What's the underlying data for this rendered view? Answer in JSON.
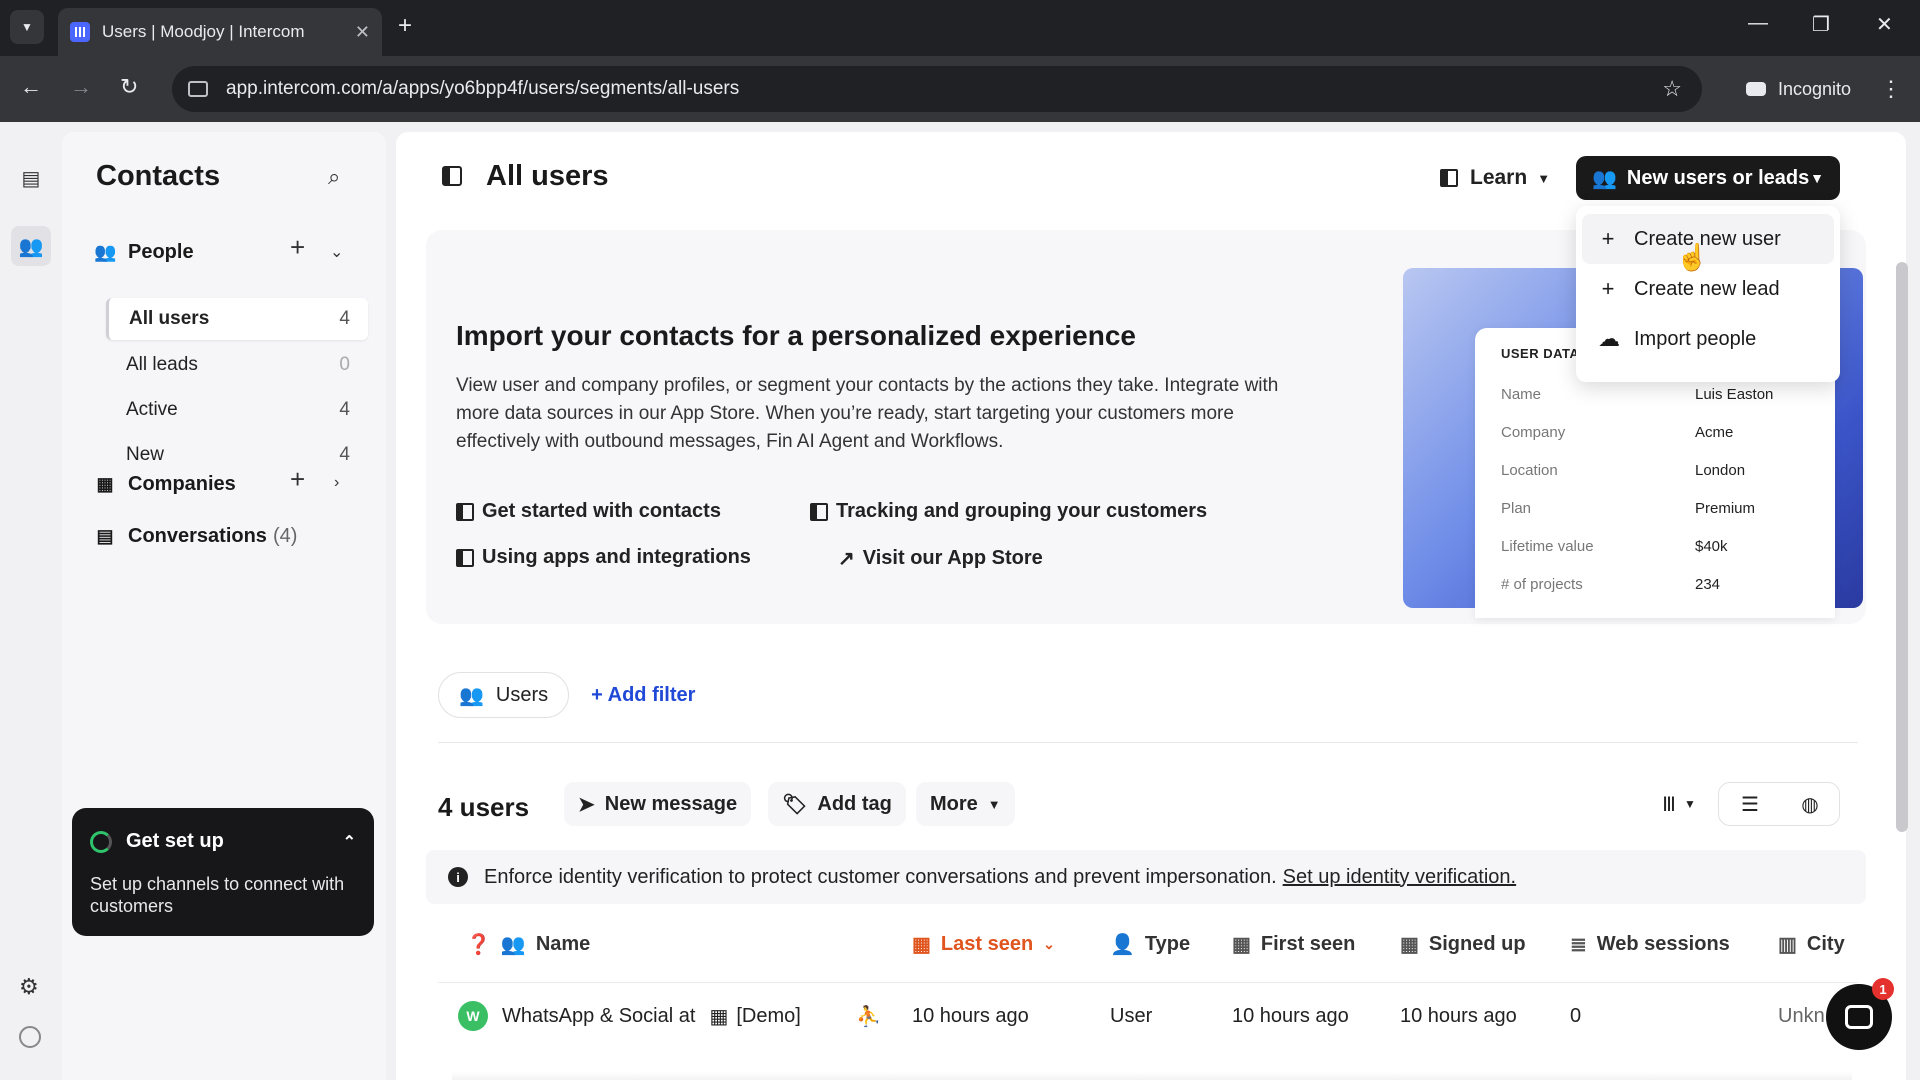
{
  "browser": {
    "tab_title": "Users | Moodjoy | Intercom",
    "url": "app.intercom.com/a/apps/yo6bpp4f/users/segments/all-users",
    "incognito_label": "Incognito"
  },
  "sidebar": {
    "title": "Contacts",
    "people_label": "People",
    "items": [
      {
        "label": "All users",
        "count": "4"
      },
      {
        "label": "All leads",
        "count": "0"
      },
      {
        "label": "Active",
        "count": "4"
      },
      {
        "label": "New",
        "count": "4"
      }
    ],
    "companies_label": "Companies",
    "conversations_label": "Conversations",
    "conversations_count": "(4)",
    "setup": {
      "title": "Get set up",
      "text": "Set up channels to connect with customers"
    }
  },
  "header": {
    "title": "All users",
    "learn_label": "Learn",
    "primary_label": "New users or leads"
  },
  "dropdown": {
    "items": [
      {
        "label": "Create new user"
      },
      {
        "label": "Create new lead"
      },
      {
        "label": "Import people"
      }
    ]
  },
  "import_card": {
    "title": "Import your contacts for a personalized experience",
    "description": "View user and company profiles, or segment your contacts by the actions they take. Integrate with more data sources in our App Store. When you’re ready, start targeting your customers more effectively with outbound messages, Fin AI Agent and Workflows.",
    "links": [
      "Get started with contacts",
      "Tracking and grouping your customers",
      "Using apps and integrations",
      "Visit our App Store"
    ],
    "user_data": {
      "header": "USER DATA",
      "rows": [
        {
          "k": "Name",
          "v": "Luis Easton"
        },
        {
          "k": "Company",
          "v": "Acme"
        },
        {
          "k": "Location",
          "v": "London"
        },
        {
          "k": "Plan",
          "v": "Premium"
        },
        {
          "k": "Lifetime value",
          "v": "$40k"
        },
        {
          "k": "# of projects",
          "v": "234"
        }
      ]
    }
  },
  "filters": {
    "segment_label": "Users",
    "add_filter_label": "Add filter"
  },
  "toolbar": {
    "count_label": "4 users",
    "new_message_label": "New message",
    "add_tag_label": "Add tag",
    "more_label": "More"
  },
  "notice": {
    "text": "Enforce identity verification to protect customer conversations and prevent impersonation.",
    "link": "Set up identity verification."
  },
  "table": {
    "columns": [
      "Name",
      "Last seen",
      "Type",
      "First seen",
      "Signed up",
      "Web sessions",
      "City"
    ],
    "rows": [
      {
        "avatar": "W",
        "name": "WhatsApp & Social at",
        "company": "[Demo]",
        "last_seen": "10 hours ago",
        "type": "User",
        "first_seen": "10 hours ago",
        "signed_up": "10 hours ago",
        "web_sessions": "0",
        "city": "Unkn"
      }
    ]
  },
  "messenger": {
    "badge": "1"
  },
  "colors": {
    "accent_blue": "#1f49d6",
    "sorted_orange": "#e0541d",
    "dark_button": "#1a1a1a"
  }
}
